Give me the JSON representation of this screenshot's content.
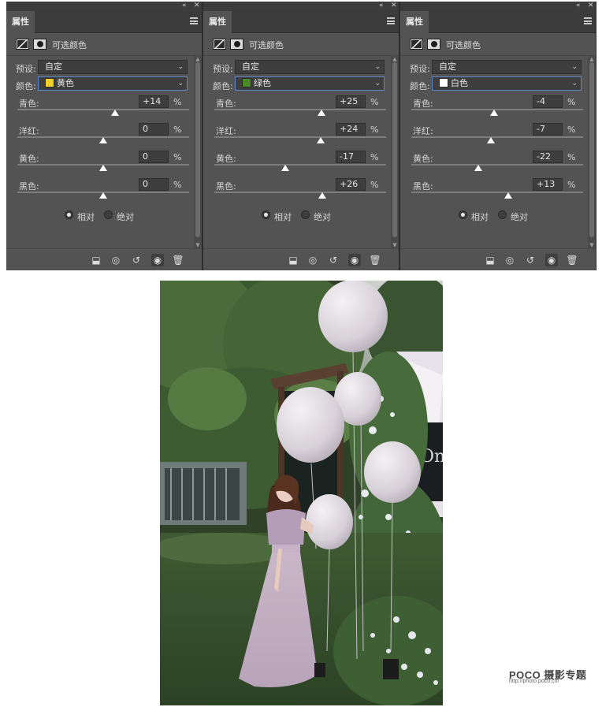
{
  "panels": [
    {
      "tab": "属性",
      "adjustment_title": "可选颜色",
      "preset_label": "预设:",
      "preset_value": "自定",
      "color_label": "颜色:",
      "color_value": "黄色",
      "color_swatch": "#f2d22a",
      "sliders": [
        {
          "label": "青色:",
          "value": "+14",
          "unit": "%",
          "level": 0.57
        },
        {
          "label": "洋红:",
          "value": "0",
          "unit": "%",
          "level": 0.5
        },
        {
          "label": "黄色:",
          "value": "0",
          "unit": "%",
          "level": 0.5
        },
        {
          "label": "黑色:",
          "value": "0",
          "unit": "%",
          "level": 0.5
        }
      ],
      "method_relative": "相对",
      "method_absolute": "绝对",
      "method_selected": "relative"
    },
    {
      "tab": "属性",
      "adjustment_title": "可选颜色",
      "preset_label": "预设:",
      "preset_value": "自定",
      "color_label": "颜色:",
      "color_value": "绿色",
      "color_swatch": "#4a8a24",
      "sliders": [
        {
          "label": "青色:",
          "value": "+25",
          "unit": "%",
          "level": 0.625
        },
        {
          "label": "洋红:",
          "value": "+24",
          "unit": "%",
          "level": 0.62
        },
        {
          "label": "黄色:",
          "value": "-17",
          "unit": "%",
          "level": 0.415
        },
        {
          "label": "黑色:",
          "value": "+26",
          "unit": "%",
          "level": 0.63
        }
      ],
      "method_relative": "相对",
      "method_absolute": "绝对",
      "method_selected": "relative"
    },
    {
      "tab": "属性",
      "adjustment_title": "可选颜色",
      "preset_label": "预设:",
      "preset_value": "自定",
      "color_label": "颜色:",
      "color_value": "白色",
      "color_swatch": "#ffffff",
      "sliders": [
        {
          "label": "青色:",
          "value": "-4",
          "unit": "%",
          "level": 0.48
        },
        {
          "label": "洋红:",
          "value": "-7",
          "unit": "%",
          "level": 0.465
        },
        {
          "label": "黄色:",
          "value": "-22",
          "unit": "%",
          "level": 0.39
        },
        {
          "label": "黑色:",
          "value": "+13",
          "unit": "%",
          "level": 0.565
        }
      ],
      "method_relative": "相对",
      "method_absolute": "绝对",
      "method_selected": "relative"
    }
  ],
  "watermark": {
    "logo": "POCO 摄影专题",
    "url": "http://photo.poco.cn/"
  },
  "colors": {
    "panel_bg": "#535353",
    "tab_bar": "#3b3b3b",
    "field_bg": "#3e3e3e",
    "active_border": "#5b86c9"
  },
  "icons": {
    "collapse": "double-chevron-left-icon",
    "close": "close-icon",
    "menu": "hamburger-menu-icon",
    "clip": "clip-to-layer-icon",
    "view_previous": "view-previous-state-icon",
    "reset": "reset-icon",
    "visibility": "eye-icon",
    "delete": "trash-icon"
  }
}
